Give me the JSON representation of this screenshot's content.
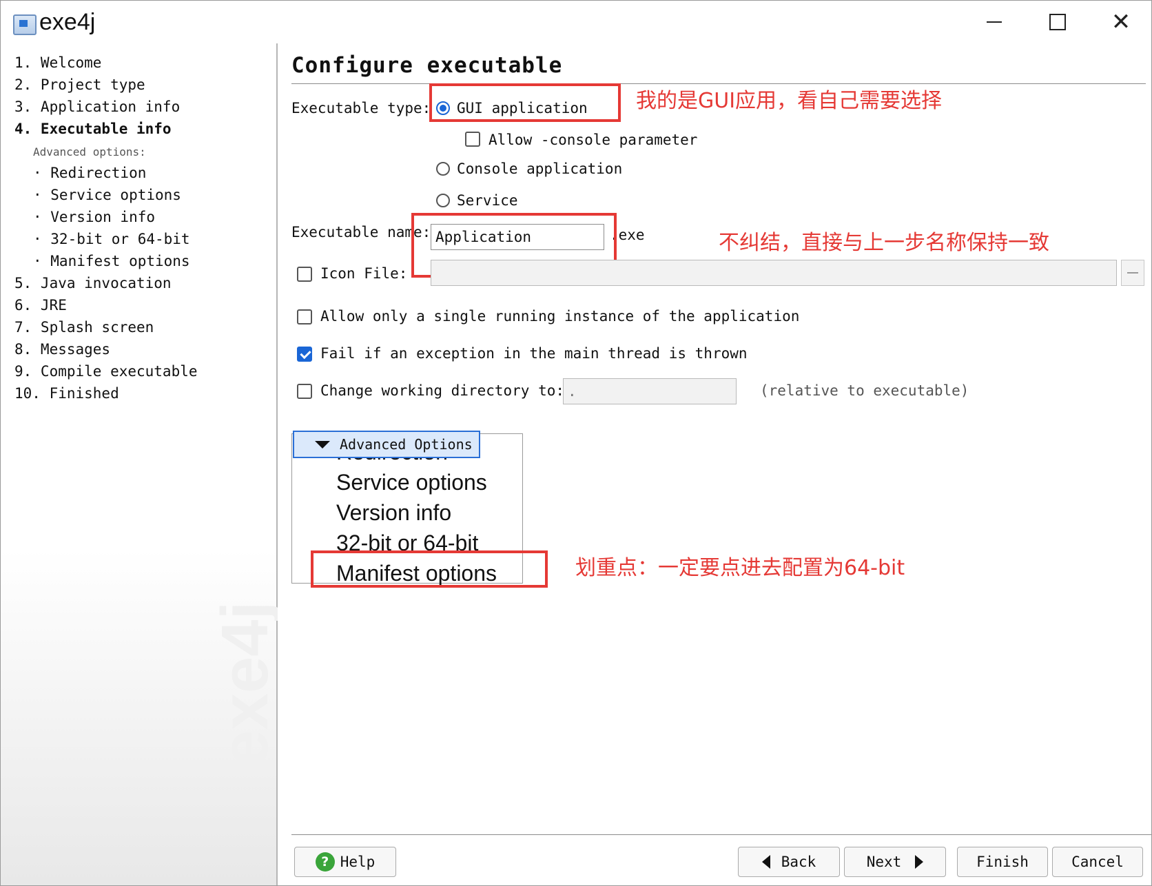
{
  "window": {
    "title": "exe4j",
    "watermark": "exe4j",
    "controls": [
      "minimize-icon",
      "maximize-icon",
      "close-icon"
    ]
  },
  "nav": {
    "items": [
      "1.  Welcome",
      "2.  Project type",
      "3.  Application info",
      "4.  Executable info",
      "5.  Java invocation",
      "6.  JRE",
      "7.  Splash screen",
      "8.  Messages",
      "9.  Compile executable",
      "10.  Finished"
    ],
    "active_index": 3,
    "sub_caption": "Advanced options:",
    "sub_items": [
      "· Redirection",
      "· Service options",
      "· Version info",
      "· 32-bit or 64-bit",
      "· Manifest options"
    ]
  },
  "main": {
    "title": "Configure executable",
    "exe_type_label": "Executable type:",
    "gui_option": "GUI application",
    "allow_console_option": "Allow -console parameter",
    "console_option": "Console application",
    "service_option": "Service",
    "exe_name_label": "Executable name:",
    "exe_name_value": "Application",
    "exe_suffix": ".exe",
    "icon_file_label": "Icon File:",
    "icon_file_value": "",
    "single_instance_label": "Allow only a single running instance of the application",
    "fail_exception_label": "Fail if an exception in the main thread is thrown",
    "change_dir_label": "Change working directory to:",
    "change_dir_value": ".",
    "relative_note": "(relative to executable)",
    "advanced_button": "Advanced Options",
    "advanced_menu": [
      "Redirection",
      "Service options",
      "Version info",
      "32-bit or 64-bit",
      "Manifest options"
    ],
    "state": {
      "gui_selected": true,
      "allow_console": false,
      "console_selected": false,
      "service_selected": false,
      "icon_file_enabled": false,
      "single_instance": false,
      "fail_exception": true,
      "change_dir": false
    }
  },
  "annotations": {
    "gui": "我的是GUI应用，看自己需要选择",
    "name": "不纠结，直接与上一步名称保持一致",
    "bitness": "划重点：一定要点进去配置为64-bit",
    "color": "#e53935"
  },
  "buttons": {
    "help": "Help",
    "back": "Back",
    "next": "Next",
    "finish": "Finish",
    "cancel": "Cancel"
  },
  "colors": {
    "accent": "#1a66d6",
    "highlight_box": "#e53935"
  }
}
